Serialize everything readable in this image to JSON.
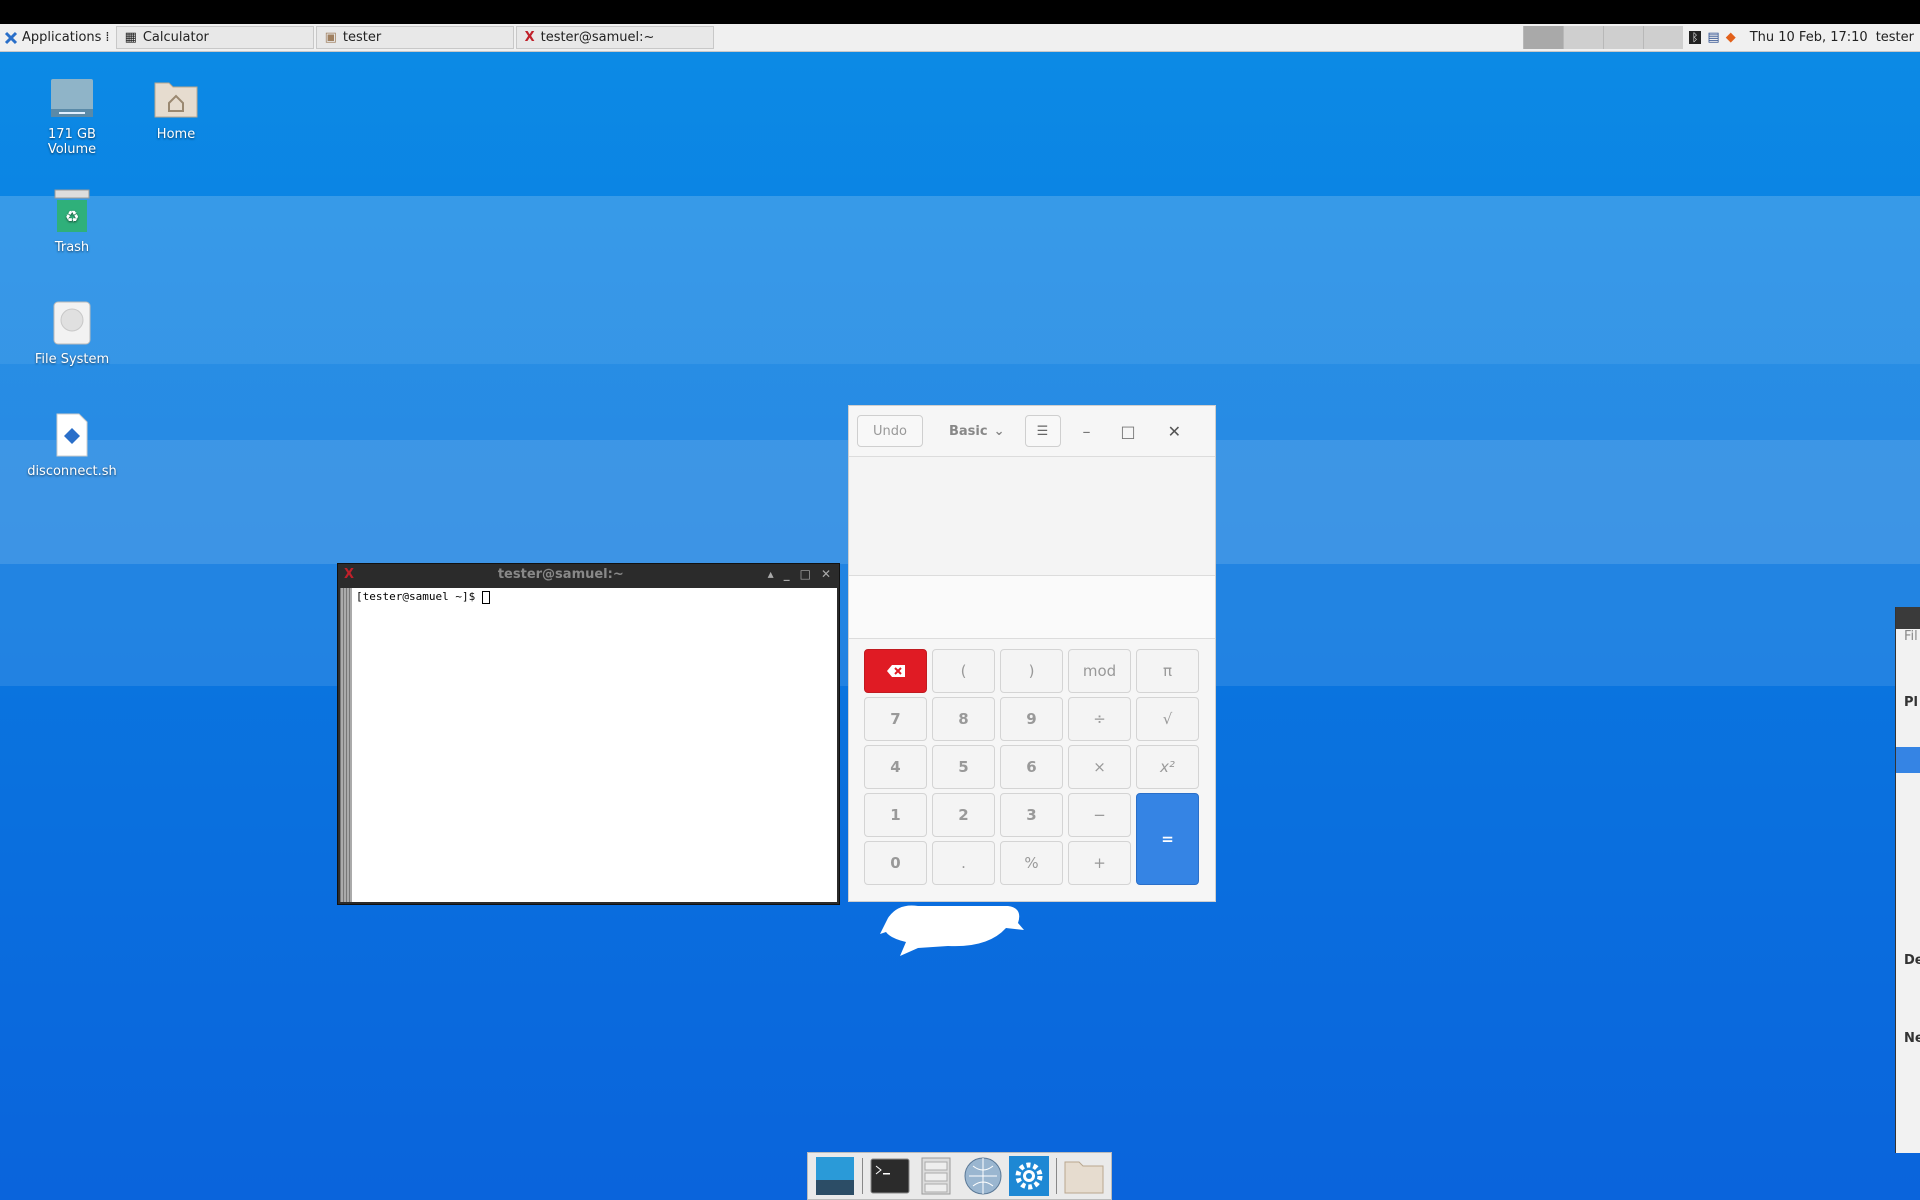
{
  "panel": {
    "applications_label": "Applications",
    "tasks": [
      {
        "label": "Calculator"
      },
      {
        "label": "tester"
      },
      {
        "label": "tester@samuel:~"
      }
    ],
    "clock": "Thu 10 Feb, 17:10",
    "user": "tester"
  },
  "desktop": {
    "icons": [
      {
        "label_line1": "171 GB",
        "label_line2": "Volume"
      },
      {
        "label_line1": "Home"
      },
      {
        "label_line1": "Trash"
      },
      {
        "label_line1": "File System"
      },
      {
        "label_line1": "disconnect.sh"
      }
    ]
  },
  "terminal": {
    "title": "tester@samuel:~",
    "prompt": "[tester@samuel ~]$ "
  },
  "calculator": {
    "undo_label": "Undo",
    "mode_label": "Basic",
    "keys": [
      "(",
      ")",
      "mod",
      "π",
      "7",
      "8",
      "9",
      "÷",
      "√",
      "4",
      "5",
      "6",
      "×",
      "x²",
      "1",
      "2",
      "3",
      "−",
      "=",
      "0",
      ".",
      "%",
      "+"
    ]
  },
  "file_manager_partial": {
    "rows": [
      "Fil",
      "Pl",
      "De",
      "Ne"
    ]
  }
}
